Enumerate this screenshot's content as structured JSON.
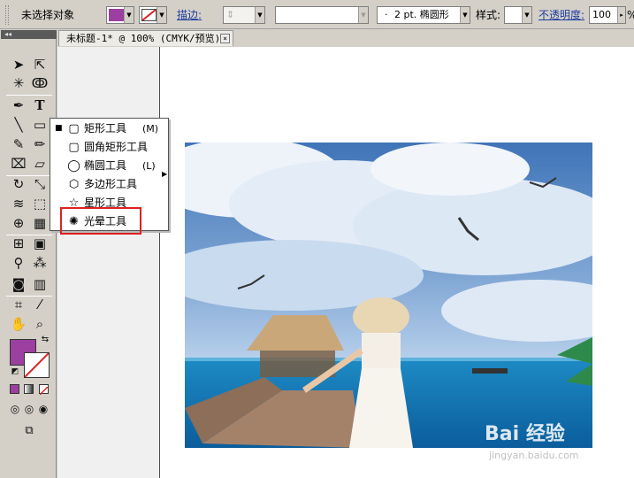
{
  "control_bar": {
    "selection_status": "未选择对象",
    "stroke_label": "描边:",
    "stroke_profile_value": "2 pt. 椭圆形",
    "style_label": "样式:",
    "opacity_label": "不透明度:",
    "opacity_value": "100",
    "percent_symbol": "%"
  },
  "tools_panel": {
    "header_glyph": "◂◂"
  },
  "document": {
    "tab_title": "未标题-1* @ 100% (CMYK/预览)",
    "tab_close": "×"
  },
  "flyout_menu": {
    "items": [
      {
        "label": "矩形工具",
        "shortcut": "(M)",
        "icon": "rectangle-icon",
        "glyph": "▢",
        "checked": true
      },
      {
        "label": "圆角矩形工具",
        "shortcut": "",
        "icon": "rounded-rectangle-icon",
        "glyph": "▢"
      },
      {
        "label": "椭圆工具",
        "shortcut": "(L)",
        "icon": "ellipse-icon",
        "glyph": "◯"
      },
      {
        "label": "多边形工具",
        "shortcut": "",
        "icon": "polygon-icon",
        "glyph": "⬡"
      },
      {
        "label": "星形工具",
        "shortcut": "",
        "icon": "star-icon",
        "glyph": "☆"
      },
      {
        "label": "光晕工具",
        "shortcut": "",
        "icon": "flare-icon",
        "glyph": "✺"
      }
    ],
    "check_glyph": "■"
  },
  "watermark": {
    "brand": "Bai  经验",
    "url": "jingyan.baidu.com"
  },
  "colors": {
    "fill_swatch": "#9b3fa0",
    "highlight": "#e02020",
    "link": "#1e3ca0"
  }
}
